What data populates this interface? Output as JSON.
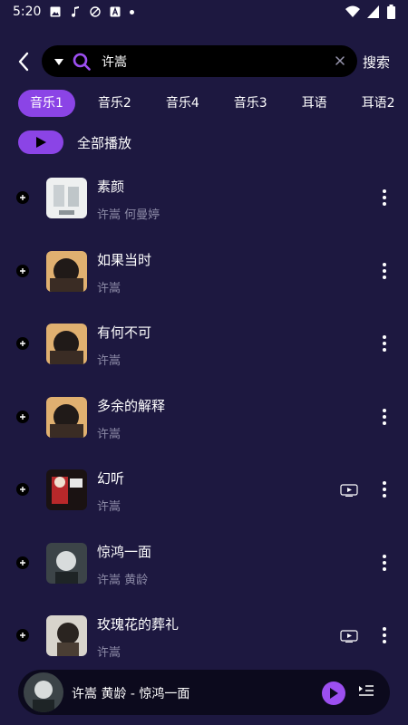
{
  "status": {
    "time": "5:20"
  },
  "header": {
    "search_value": "许嵩",
    "search_button": "搜索"
  },
  "tabs": [
    {
      "label": "音乐1",
      "active": true
    },
    {
      "label": "音乐2",
      "active": false
    },
    {
      "label": "音乐4",
      "active": false
    },
    {
      "label": "音乐3",
      "active": false
    },
    {
      "label": "耳语",
      "active": false
    },
    {
      "label": "耳语2",
      "active": false
    }
  ],
  "play_all": {
    "label": "全部播放"
  },
  "songs": [
    {
      "title": "素颜",
      "artist": "许嵩 何曼婷",
      "has_mv": false
    },
    {
      "title": "如果当时",
      "artist": "许嵩",
      "has_mv": false
    },
    {
      "title": "有何不可",
      "artist": "许嵩",
      "has_mv": false
    },
    {
      "title": "多余的解释",
      "artist": "许嵩",
      "has_mv": false
    },
    {
      "title": "幻听",
      "artist": "许嵩",
      "has_mv": true
    },
    {
      "title": "惊鸿一面",
      "artist": "许嵩 黄龄",
      "has_mv": false
    },
    {
      "title": "玫瑰花的葬礼",
      "artist": "许嵩",
      "has_mv": true
    }
  ],
  "mini_player": {
    "title": "许嵩 黄龄 - 惊鸿一面"
  },
  "colors": {
    "accent": "#8b44e6",
    "background": "#1d1840",
    "secondary_text": "#8c8aa6"
  }
}
